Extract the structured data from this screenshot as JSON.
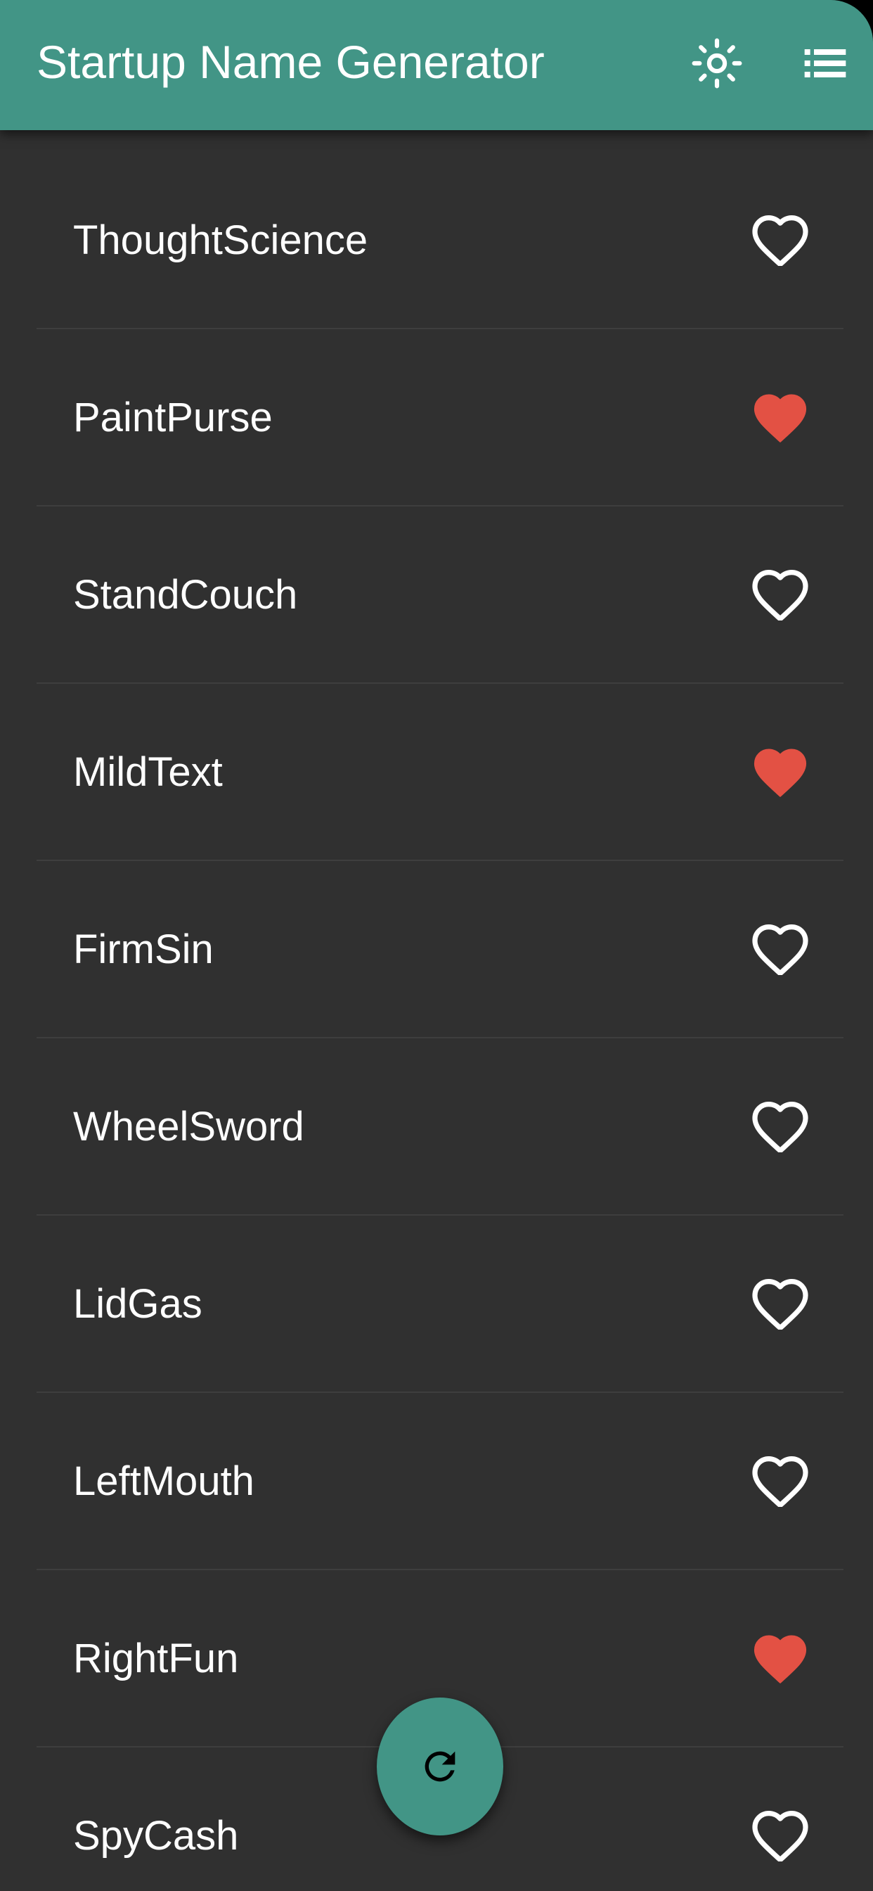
{
  "app": {
    "title": "Startup Name Generator"
  },
  "colors": {
    "appbar": "#429586",
    "background": "#303030",
    "favorite": "#e35144",
    "text": "#ffffff"
  },
  "icons": {
    "theme_toggle": "sun-icon",
    "saved_list": "list-icon",
    "favorite_on": "heart-filled-icon",
    "favorite_off": "heart-outline-icon",
    "refresh": "refresh-icon"
  },
  "suggestions": [
    {
      "name": "ThoughtScience",
      "favorite": false
    },
    {
      "name": "PaintPurse",
      "favorite": true
    },
    {
      "name": "StandCouch",
      "favorite": false
    },
    {
      "name": "MildText",
      "favorite": true
    },
    {
      "name": "FirmSin",
      "favorite": false
    },
    {
      "name": "WheelSword",
      "favorite": false
    },
    {
      "name": "LidGas",
      "favorite": false
    },
    {
      "name": "LeftMouth",
      "favorite": false
    },
    {
      "name": "RightFun",
      "favorite": true
    },
    {
      "name": "SpyCash",
      "favorite": false
    }
  ]
}
